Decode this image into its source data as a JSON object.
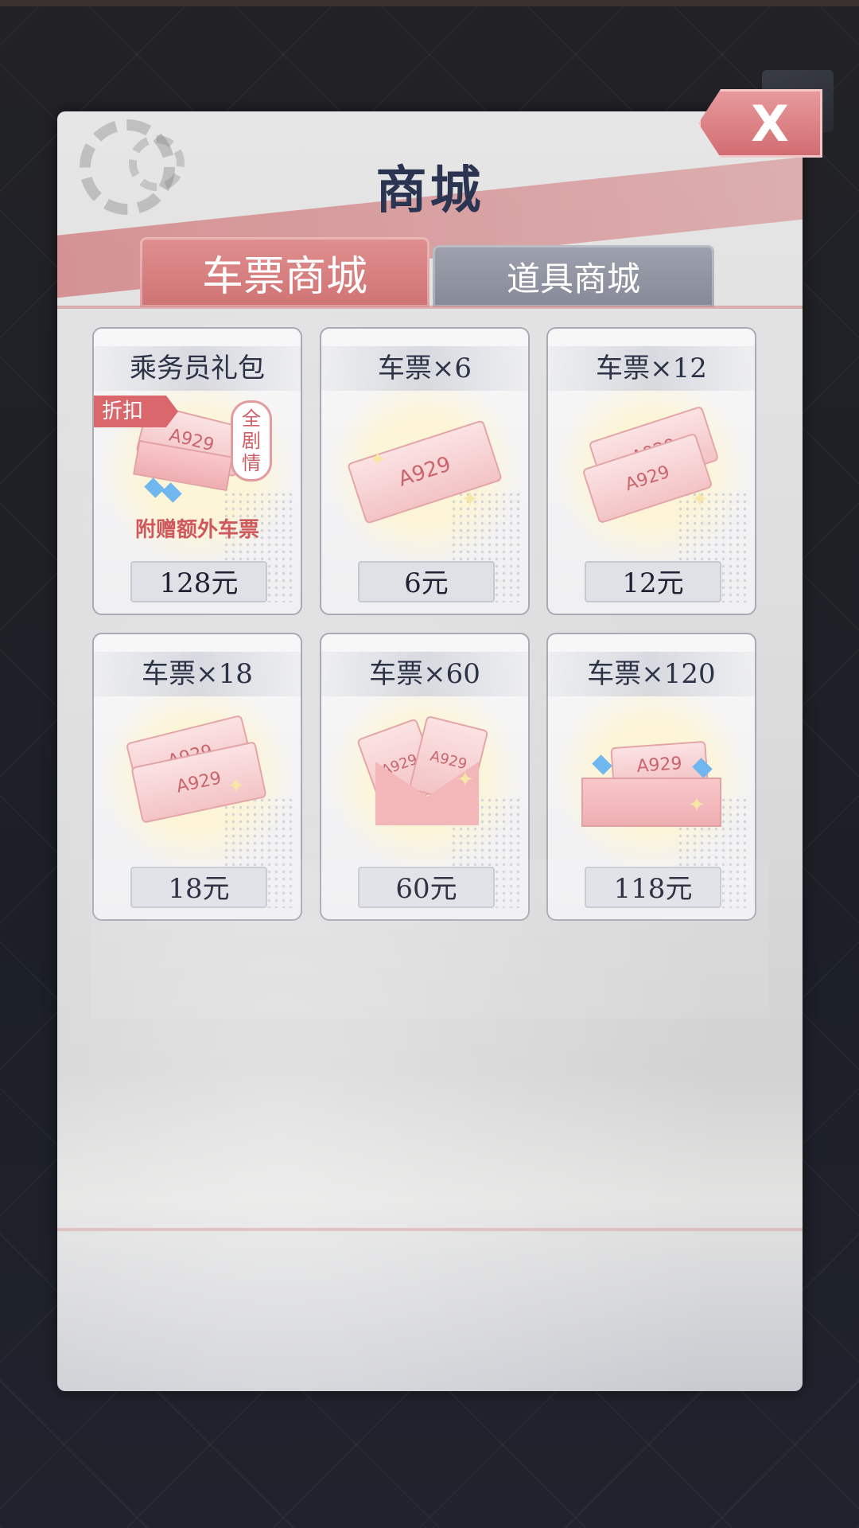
{
  "shop": {
    "title": "商城",
    "tabs": [
      {
        "label": "车票商城",
        "active": true
      },
      {
        "label": "道具商城",
        "active": false
      }
    ],
    "close_label": "X",
    "products": [
      {
        "name": "乘务员礼包",
        "price": "128元",
        "badge": "折扣",
        "tag_chars": [
          "全",
          "剧",
          "情"
        ],
        "note": "附赠额外车票",
        "image": "gift-pack"
      },
      {
        "name": "车票×6",
        "price": "6元",
        "ticket_code": "A929",
        "image": "single-ticket"
      },
      {
        "name": "车票×12",
        "price": "12元",
        "ticket_code": "A929",
        "image": "double-ticket"
      },
      {
        "name": "车票×18",
        "price": "18元",
        "ticket_code": "A929",
        "image": "ticket-stack"
      },
      {
        "name": "车票×60",
        "price": "60元",
        "ticket_code": "A929",
        "image": "ticket-envelope"
      },
      {
        "name": "车票×120",
        "price": "118元",
        "ticket_code": "A929",
        "image": "ticket-box"
      }
    ]
  },
  "colors": {
    "accent": "#d26d72",
    "title": "#2b3450",
    "tab_inactive": "#868a98",
    "panel": "#dcdcdc"
  }
}
